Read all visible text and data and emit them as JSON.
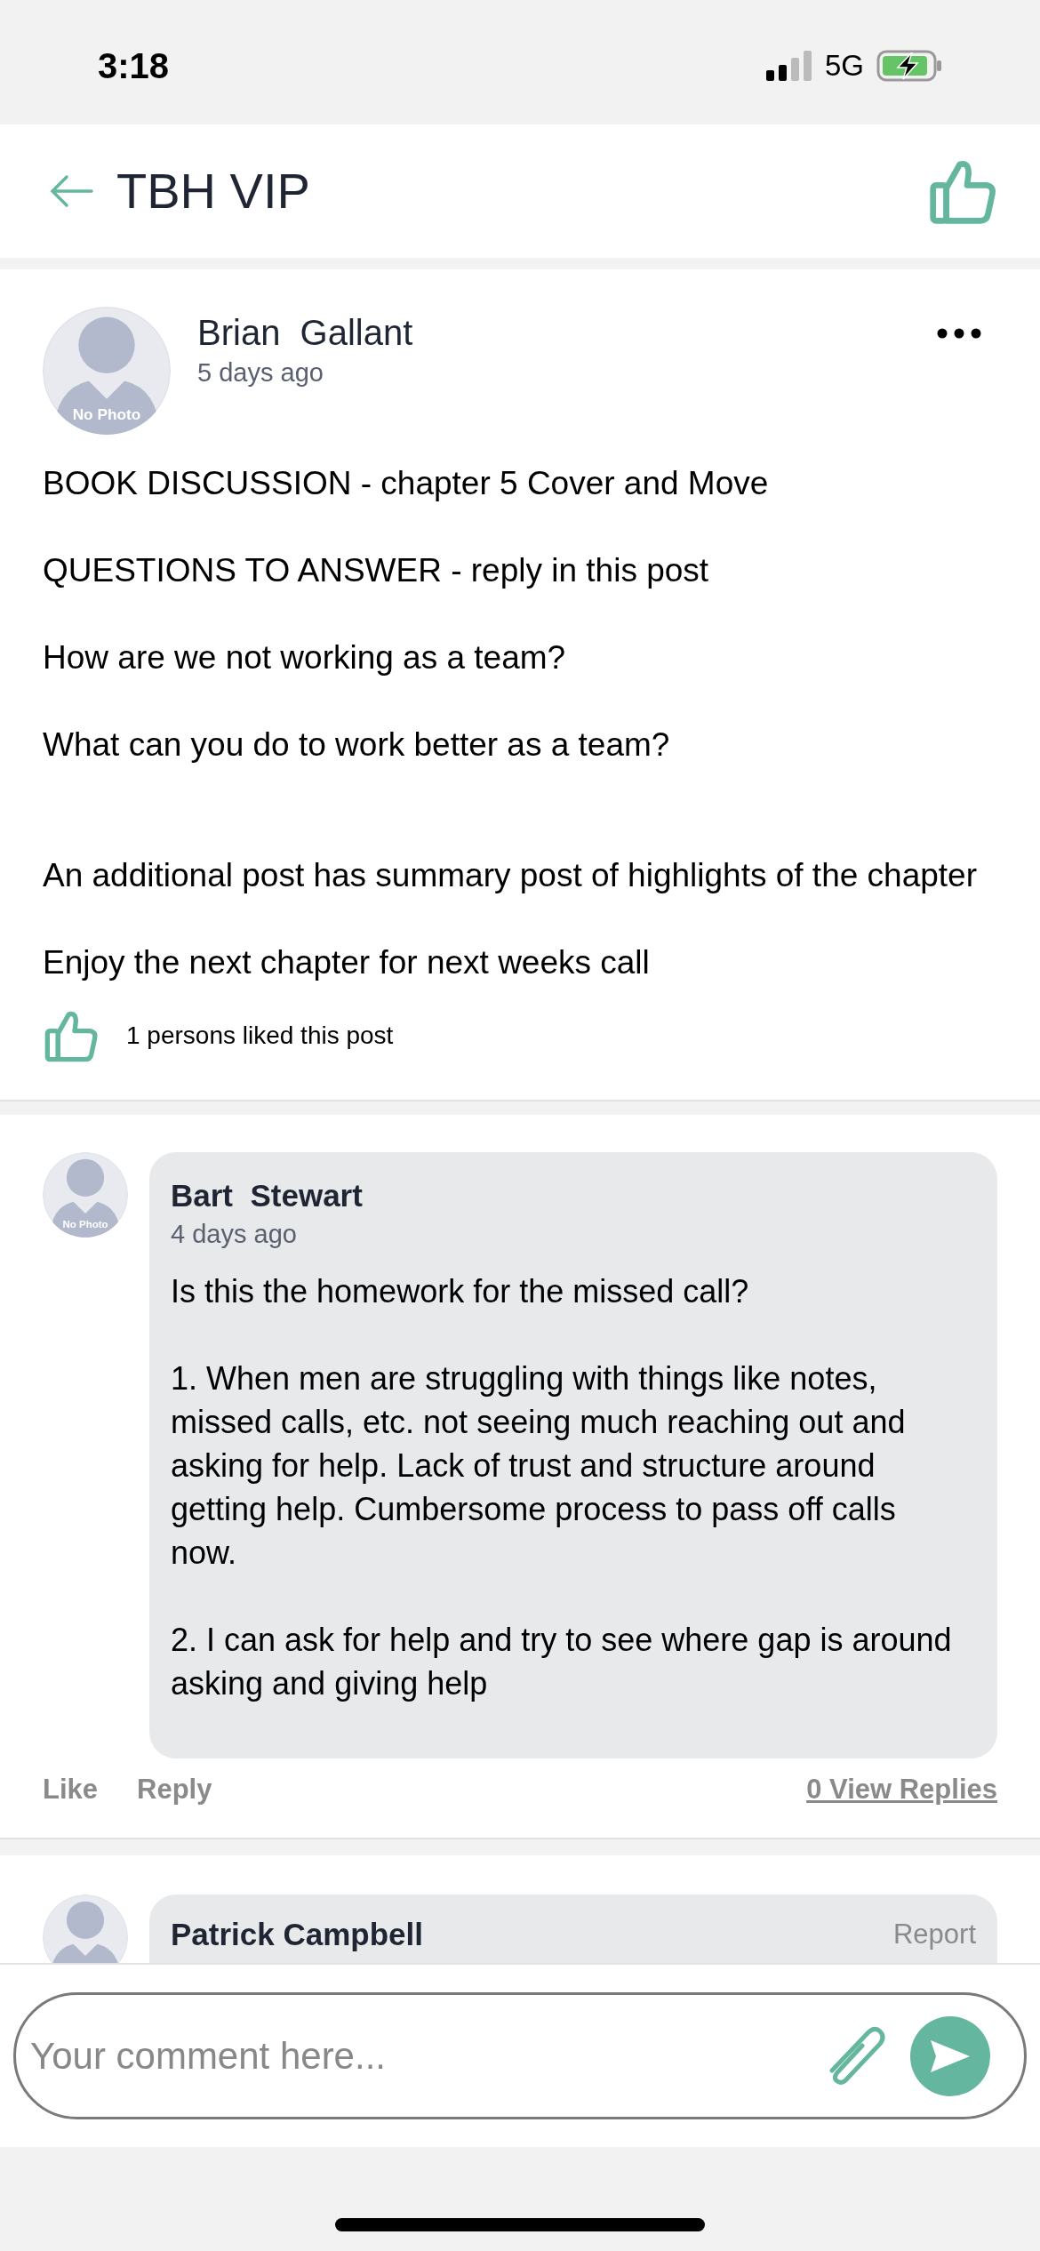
{
  "status_bar": {
    "time": "3:18",
    "network": "5G"
  },
  "header": {
    "title": "TBH VIP"
  },
  "post": {
    "author": "Brian  Gallant",
    "time": "5 days ago",
    "avatar_label": "No Photo",
    "body": "BOOK DISCUSSION - chapter 5 Cover and Move\n\nQUESTIONS TO ANSWER - reply in this post\n\nHow are we not working as a team?\n\nWhat can you do to work better as a team?\n\n\nAn additional post has summary post of highlights of the chapter\n\nEnjoy the next chapter for next weeks call",
    "likes": "1 persons liked this post"
  },
  "comments": [
    {
      "author": "Bart  Stewart",
      "time": "4 days ago",
      "avatar_label": "No Photo",
      "body": "Is this the homework for the missed call?\n\n1. When men are struggling with things like notes, missed calls, etc. not seeing much reaching out and asking for help. Lack of trust and structure around getting help. Cumbersome process to pass off calls now.\n\n2. I can ask for help and try to see where gap is around asking and giving help",
      "actions": [
        "Like",
        "Reply"
      ],
      "replies": "0 View Replies"
    },
    {
      "author": "Patrick Campbell",
      "report": "Report"
    }
  ],
  "composer": {
    "placeholder": "Your comment here..."
  }
}
